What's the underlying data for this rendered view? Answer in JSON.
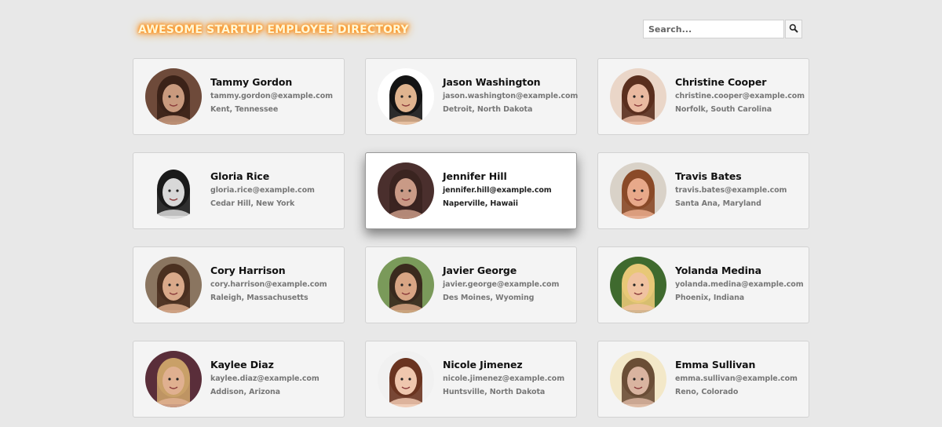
{
  "header": {
    "title": "AWESOME STARTUP EMPLOYEE DIRECTORY"
  },
  "search": {
    "placeholder": "Search...",
    "button_icon": "search-icon"
  },
  "employees": [
    {
      "name": "Tammy Gordon",
      "email": "tammy.gordon@example.com",
      "location": "Kent, Tennessee",
      "skin": "#c99a7e",
      "hair": "#3b2218",
      "bg": "#6e4a3a"
    },
    {
      "name": "Jason Washington",
      "email": "jason.washington@example.com",
      "location": "Detroit, North Dakota",
      "skin": "#e0b48f",
      "hair": "#141414",
      "bg": "#ffffff"
    },
    {
      "name": "Christine Cooper",
      "email": "christine.cooper@example.com",
      "location": "Norfolk, South Carolina",
      "skin": "#e9b9a0",
      "hair": "#5a2f1e",
      "bg": "#ead6c8"
    },
    {
      "name": "Gloria Rice",
      "email": "gloria.rice@example.com",
      "location": "Cedar Hill, New York",
      "skin": "#d8d8d8",
      "hair": "#1a1a1a",
      "bg": "#f4f4f4"
    },
    {
      "name": "Jennifer Hill",
      "email": "jennifer.hill@example.com",
      "location": "Naperville, Hawaii",
      "skin": "#c99a86",
      "hair": "#3a2420",
      "bg": "#4a2f2d"
    },
    {
      "name": "Travis Bates",
      "email": "travis.bates@example.com",
      "location": "Santa Ana, Maryland",
      "skin": "#e8a98a",
      "hair": "#8a4a28",
      "bg": "#d9d2c8"
    },
    {
      "name": "Cory Harrison",
      "email": "cory.harrison@example.com",
      "location": "Raleigh, Massachusetts",
      "skin": "#d9a98a",
      "hair": "#4a3020",
      "bg": "#8a7560"
    },
    {
      "name": "Javier George",
      "email": "javier.george@example.com",
      "location": "Des Moines, Wyoming",
      "skin": "#d8a584",
      "hair": "#3a2a1e",
      "bg": "#7a9a5a"
    },
    {
      "name": "Yolanda Medina",
      "email": "yolanda.medina@example.com",
      "location": "Phoenix, Indiana",
      "skin": "#f0c2a0",
      "hair": "#e8c877",
      "bg": "#3f6a2e"
    },
    {
      "name": "Kaylee Diaz",
      "email": "kaylee.diaz@example.com",
      "location": "Addison, Arizona",
      "skin": "#e0b090",
      "hair": "#c9a068",
      "bg": "#5a2e3a"
    },
    {
      "name": "Nicole Jimenez",
      "email": "nicole.jimenez@example.com",
      "location": "Huntsville, North Dakota",
      "skin": "#efc7ae",
      "hair": "#6a3420",
      "bg": "#f1f1f1"
    },
    {
      "name": "Emma Sullivan",
      "email": "emma.sullivan@example.com",
      "location": "Reno, Colorado",
      "skin": "#d9b4a0",
      "hair": "#6a4e36",
      "bg": "#f3e8c8"
    }
  ],
  "active_index": 4
}
